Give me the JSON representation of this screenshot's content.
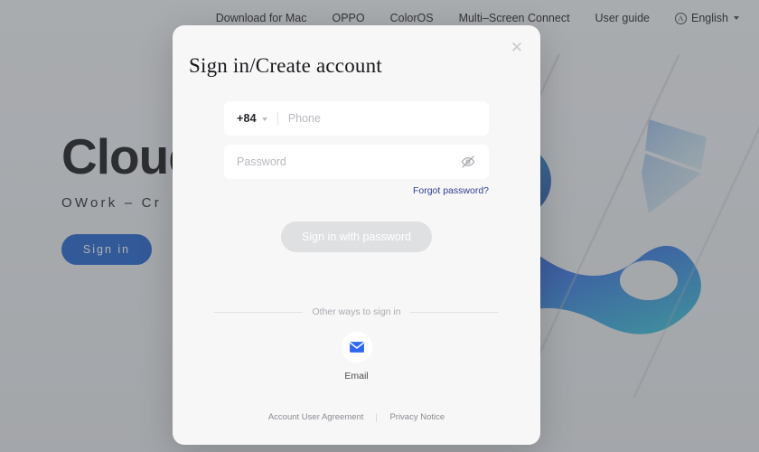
{
  "topnav": {
    "items": [
      {
        "label": "Download for Mac",
        "name": "nav-download-mac"
      },
      {
        "label": "OPPO",
        "name": "nav-oppo"
      },
      {
        "label": "ColorOS",
        "name": "nav-coloros"
      },
      {
        "label": "Multi–Screen Connect",
        "name": "nav-multiscreen-connect"
      },
      {
        "label": "User guide",
        "name": "nav-user-guide"
      }
    ],
    "language": {
      "icon": "language-globe-icon",
      "glyph": "A",
      "label": "English",
      "caret": "chevron-down-icon"
    }
  },
  "hero": {
    "title": "Cloud",
    "subtitle": "OWork – Cr",
    "signin_label": "Sign in",
    "accent_color": "#1b5fce"
  },
  "modal": {
    "title": "Sign in/Create account",
    "close_icon": "close-icon",
    "close_glyph": "✕",
    "phone": {
      "country_code": "+84",
      "caret_icon": "chevron-down-icon",
      "placeholder": "Phone",
      "value": ""
    },
    "password": {
      "placeholder": "Password",
      "value": "",
      "toggle_icon": "eye-off-icon"
    },
    "forgot_label": "Forgot password?",
    "forgot_color": "#2e3f8f",
    "submit_label": "Sign in with password",
    "submit_disabled_color": "#dfe0e2",
    "other_ways_label": "Other ways to sign in",
    "social": {
      "icon": "email-icon",
      "label": "Email",
      "color": "#2d68f5"
    },
    "footer": {
      "agreement_label": "Account User Agreement",
      "privacy_label": "Privacy Notice"
    }
  }
}
